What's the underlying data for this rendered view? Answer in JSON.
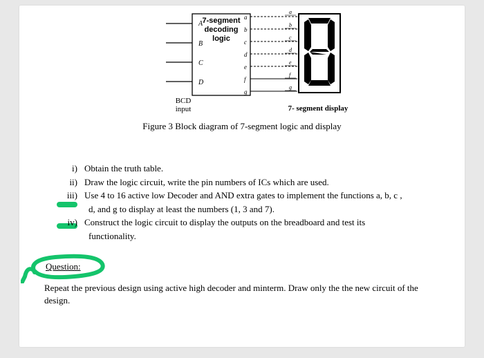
{
  "diagram": {
    "box_title1": "7-segment",
    "box_title2": "decoding",
    "box_title3": "logic",
    "inputs": [
      "A",
      "B",
      "C",
      "D"
    ],
    "input_group_label": "BCD",
    "input_group_label2": "input",
    "outputs": [
      "a",
      "b",
      "c",
      "d",
      "e",
      "f",
      "g"
    ],
    "display_pins": [
      "a",
      "b",
      "c",
      "d",
      "e",
      "f",
      "g"
    ],
    "display_caption": "7- segment display"
  },
  "figure_caption": "Figure 3 Block diagram of 7-segment logic and display",
  "tasks": [
    {
      "marker": "i)",
      "text": "Obtain the truth table."
    },
    {
      "marker": "ii)",
      "text": "Draw the logic circuit, write the pin numbers of ICs which are used."
    },
    {
      "marker": "iii)",
      "text": "Use 4 to 16 active low Decoder and AND extra gates to implement the functions a, b, c ,"
    },
    {
      "marker": "",
      "text": "d, and g to display at least the numbers (1, 3 and 7)."
    },
    {
      "marker": "iv)",
      "text": "Construct the logic circuit to display the outputs on the breadboard and test its"
    },
    {
      "marker": "",
      "text": "functionality."
    }
  ],
  "question_label": "Question:",
  "followup_text": "Repeat the previous design using active high decoder and minterm. Draw only the the new circuit of the design."
}
